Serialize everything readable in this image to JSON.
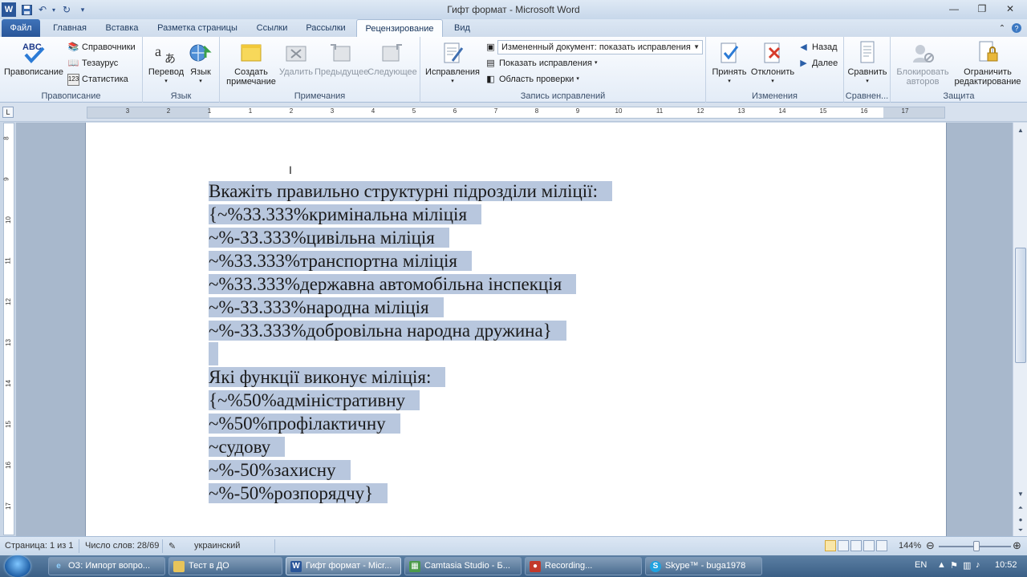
{
  "window": {
    "title": "Гифт формат  -  Microsoft Word"
  },
  "tabs": [
    {
      "label": "Файл"
    },
    {
      "label": "Главная"
    },
    {
      "label": "Вставка"
    },
    {
      "label": "Разметка страницы"
    },
    {
      "label": "Ссылки"
    },
    {
      "label": "Рассылки"
    },
    {
      "label": "Рецензирование"
    },
    {
      "label": "Вид"
    }
  ],
  "ribbon": {
    "proofing": {
      "group_label": "Правописание",
      "spelling": "Правописание",
      "research": "Справочники",
      "thesaurus": "Тезаурус",
      "wordcount": "Статистика"
    },
    "language": {
      "group_label": "Язык",
      "translate": "Перевод",
      "language": "Язык"
    },
    "comments": {
      "group_label": "Примечания",
      "new_line1": "Создать",
      "new_line2": "примечание",
      "delete": "Удалить",
      "previous": "Предыдущее",
      "next": "Следующее"
    },
    "tracking": {
      "group_label": "Запись исправлений",
      "track_changes": "Исправления",
      "display_mode": "Измененный документ: показать исправления",
      "show_markup": "Показать исправления",
      "reviewing_pane": "Область проверки"
    },
    "changes": {
      "group_label": "Изменения",
      "accept": "Принять",
      "reject": "Отклонить",
      "previous": "Назад",
      "next": "Далее"
    },
    "compare": {
      "group_label": "Сравнен...",
      "compare": "Сравнить"
    },
    "protect": {
      "group_label": "Защита",
      "block_line1": "Блокировать",
      "block_line2": "авторов",
      "restrict_line1": "Ограничить",
      "restrict_line2": "редактирование"
    }
  },
  "ruler": {
    "h_numbers": [
      "3",
      "2",
      "1",
      "1",
      "2",
      "3",
      "4",
      "5",
      "6",
      "7",
      "8",
      "9",
      "10",
      "11",
      "12",
      "13",
      "14",
      "15",
      "16",
      "17"
    ],
    "v_numbers": [
      "8",
      "9",
      "10",
      "11",
      "12",
      "13",
      "14",
      "15",
      "16",
      "17"
    ]
  },
  "document": {
    "lines": [
      "Вкажіть правильно структурні підрозділи міліції:",
      "{~%33.333%кримінальна міліція",
      "~%-33.333%цивільна міліція",
      "~%33.333%транспортна міліція",
      "~%33.333%державна автомобільна інспекція",
      "~%-33.333%народна міліція",
      "~%-33.333%добровільна народна дружина}",
      "",
      "Які функції виконує міліція:",
      "{~%50%адміністративну",
      "~%50%профілактичну",
      "~судову",
      "~%-50%захисну",
      "~%-50%розпорядчу}"
    ]
  },
  "status": {
    "page": "Страница: 1 из 1",
    "words": "Число слов: 28/69",
    "language": "украинский",
    "zoom": "144%"
  },
  "taskbar": {
    "items": [
      {
        "label": "ОЗ: Импорт вопро..."
      },
      {
        "label": "Тест в ДО"
      },
      {
        "label": "Гифт формат - Micr..."
      },
      {
        "label": "Camtasia Studio - Б..."
      },
      {
        "label": "Recording..."
      },
      {
        "label": "Skype™ - buga1978"
      }
    ],
    "lang": "EN",
    "time": "10:52"
  },
  "colors": {
    "selection": "#b8c7de",
    "file_tab": "#2a5699",
    "taskbar": "#3a5f86"
  }
}
